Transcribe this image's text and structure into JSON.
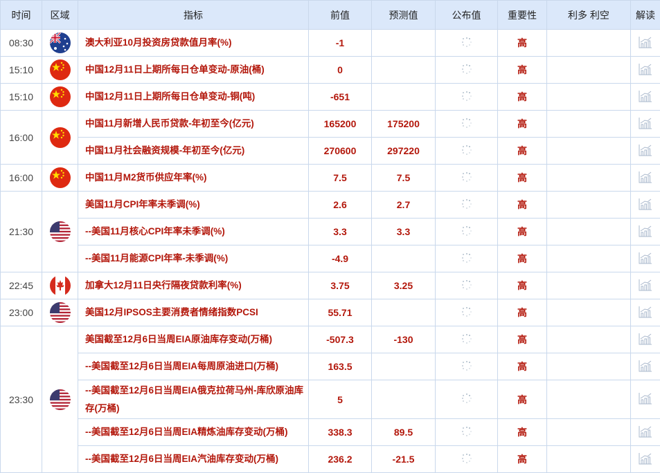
{
  "header": [
    "时间",
    "区域",
    "指标",
    "前值",
    "预测值",
    "公布值",
    "重要性",
    "利多 利空",
    "解读"
  ],
  "groups": [
    {
      "time": "08:30",
      "flag": "australia",
      "rows": [
        {
          "indicator": "澳大利亚10月投资房贷款值月率(%)",
          "previous": "-1",
          "forecast": "",
          "actual": "",
          "importance": "高"
        }
      ]
    },
    {
      "time": "15:10",
      "flag": "china",
      "rows": [
        {
          "indicator": "中国12月11日上期所每日仓单变动-原油(桶)",
          "previous": "0",
          "forecast": "",
          "actual": "",
          "importance": "高"
        }
      ]
    },
    {
      "time": "15:10",
      "flag": "china",
      "rows": [
        {
          "indicator": "中国12月11日上期所每日仓单变动-铜(吨)",
          "previous": "-651",
          "forecast": "",
          "actual": "",
          "importance": "高"
        }
      ]
    },
    {
      "time": "16:00",
      "flag": "china",
      "rows": [
        {
          "indicator": "中国11月新增人民币贷款-年初至今(亿元)",
          "previous": "165200",
          "forecast": "175200",
          "actual": "",
          "importance": "高"
        },
        {
          "indicator": "中国11月社会融资规模-年初至今(亿元)",
          "previous": "270600",
          "forecast": "297220",
          "actual": "",
          "importance": "高"
        }
      ]
    },
    {
      "time": "16:00",
      "flag": "china",
      "rows": [
        {
          "indicator": "中国11月M2货币供应年率(%)",
          "previous": "7.5",
          "forecast": "7.5",
          "actual": "",
          "importance": "高"
        }
      ]
    },
    {
      "time": "21:30",
      "flag": "usa",
      "rows": [
        {
          "indicator": "美国11月CPI年率未季调(%)",
          "previous": "2.6",
          "forecast": "2.7",
          "actual": "",
          "importance": "高"
        },
        {
          "indicator": "--美国11月核心CPI年率未季调(%)",
          "previous": "3.3",
          "forecast": "3.3",
          "actual": "",
          "importance": "高"
        },
        {
          "indicator": "--美国11月能源CPI年率-未季调(%)",
          "previous": "-4.9",
          "forecast": "",
          "actual": "",
          "importance": "高"
        }
      ]
    },
    {
      "time": "22:45",
      "flag": "canada",
      "rows": [
        {
          "indicator": "加拿大12月11日央行隔夜贷款利率(%)",
          "previous": "3.75",
          "forecast": "3.25",
          "actual": "",
          "importance": "高"
        }
      ]
    },
    {
      "time": "23:00",
      "flag": "usa",
      "rows": [
        {
          "indicator": "美国12月IPSOS主要消费者情绪指数PCSI",
          "previous": "55.71",
          "forecast": "",
          "actual": "",
          "importance": "高"
        }
      ]
    },
    {
      "time": "23:30",
      "flag": "usa",
      "rows": [
        {
          "indicator": "美国截至12月6日当周EIA原油库存变动(万桶)",
          "previous": "-507.3",
          "forecast": "-130",
          "actual": "",
          "importance": "高"
        },
        {
          "indicator": "--美国截至12月6日当周EIA每周原油进口(万桶)",
          "previous": "163.5",
          "forecast": "",
          "actual": "",
          "importance": "高"
        },
        {
          "indicator": "--美国截至12月6日当周EIA俄克拉荷马州-库欣原油库存(万桶)",
          "previous": "5",
          "forecast": "",
          "actual": "",
          "importance": "高",
          "tall": true
        },
        {
          "indicator": "--美国截至12月6日当周EIA精炼油库存变动(万桶)",
          "previous": "338.3",
          "forecast": "89.5",
          "actual": "",
          "importance": "高"
        },
        {
          "indicator": "--美国截至12月6日当周EIA汽油库存变动(万桶)",
          "previous": "236.2",
          "forecast": "-21.5",
          "actual": "",
          "importance": "高"
        }
      ]
    }
  ],
  "colors": {
    "accent": "#b3170b",
    "header_bg": "#dbe8fa",
    "border": "#c9d8ec"
  }
}
